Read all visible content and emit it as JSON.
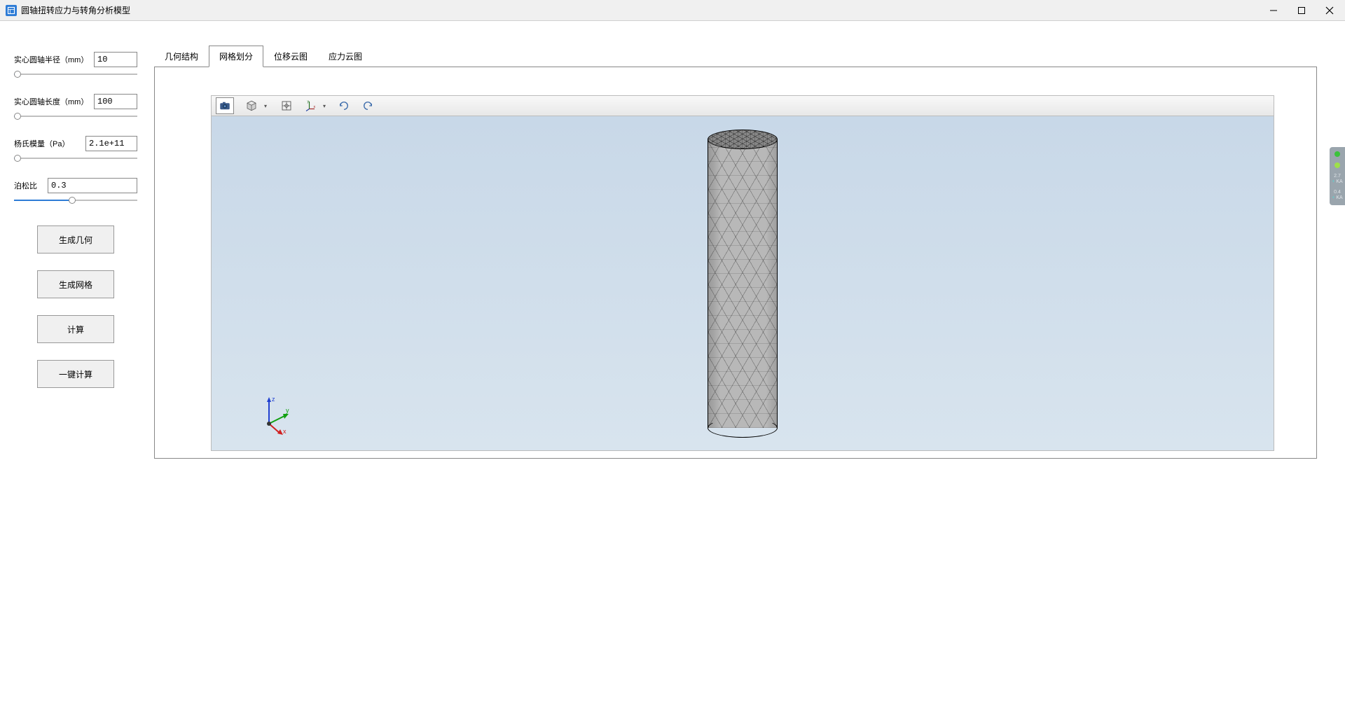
{
  "window": {
    "title": "圆轴扭转应力与转角分析模型"
  },
  "sidebar": {
    "params": {
      "radius": {
        "label": "实心圆轴半径（mm）",
        "value": "10",
        "slider_pct": 3
      },
      "length": {
        "label": "实心圆轴长度（mm）",
        "value": "100",
        "slider_pct": 3
      },
      "youngs": {
        "label": "杨氏模量（Pa）",
        "value": "2.1e+11",
        "slider_pct": 3
      },
      "poisson": {
        "label": "泊松比",
        "value": "0.3",
        "slider_pct": 47
      }
    },
    "buttons": {
      "gen_geom": "生成几何",
      "gen_mesh": "生成网格",
      "compute": "计算",
      "one_click": "一键计算"
    }
  },
  "tabs": {
    "items": [
      "几何结构",
      "网格划分",
      "位移云图",
      "应力云图"
    ],
    "active_index": 1
  },
  "toolbar": {
    "icons": [
      "camera-icon",
      "cube-view-icon",
      "fit-view-icon",
      "axes-icon",
      "rotate-ccw-icon",
      "rotate-cw-icon"
    ]
  },
  "triad": {
    "x": "x",
    "y": "y",
    "z": "z"
  },
  "right_panel": {
    "status1": "green",
    "status2": "lime",
    "row1": {
      "num": "2.7",
      "sub": "KA"
    },
    "row2": {
      "num": "0.4",
      "sub": "KA"
    }
  }
}
